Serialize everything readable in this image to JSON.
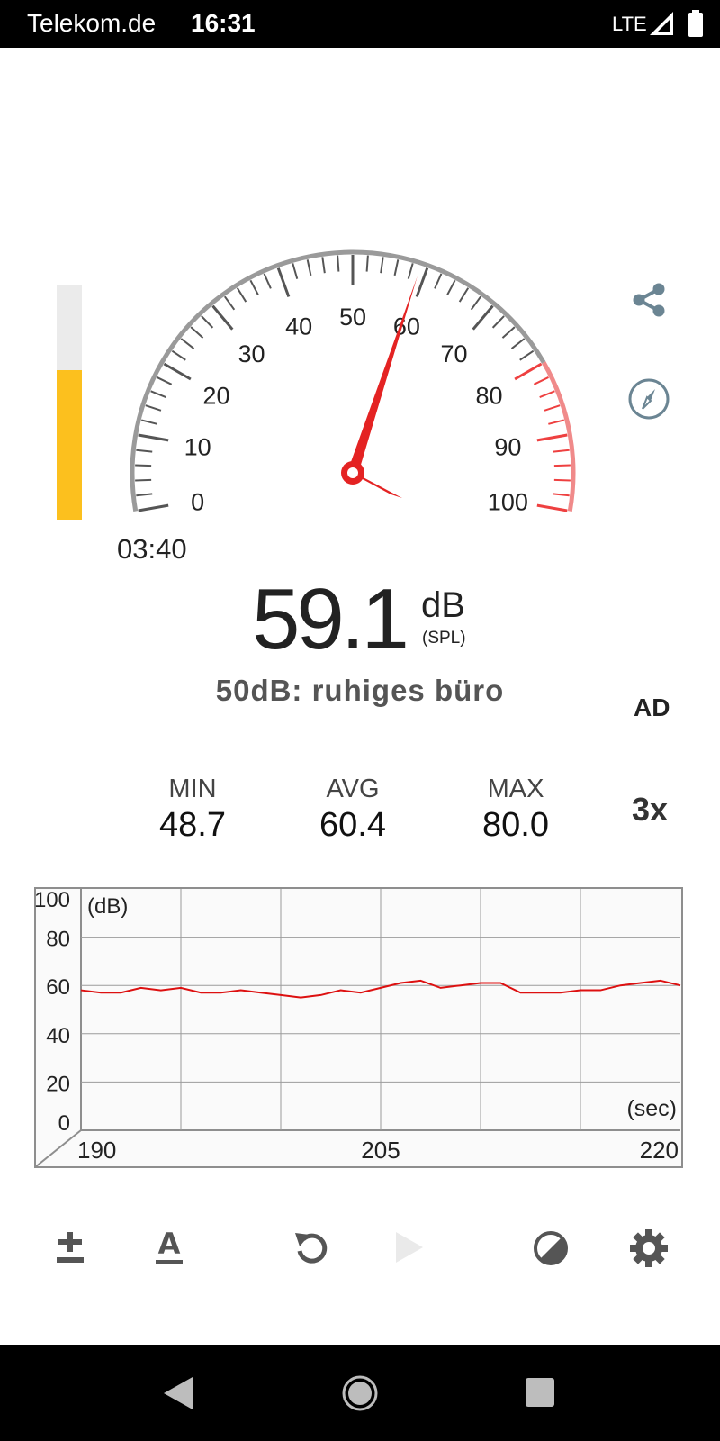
{
  "status_bar": {
    "carrier": "Telekom.de",
    "time": "16:31",
    "network": "LTE"
  },
  "level_meter": {
    "level": 0.64,
    "fill_color": "#fcc01e"
  },
  "gauge": {
    "tick_labels": [
      "0",
      "10",
      "20",
      "30",
      "40",
      "50",
      "60",
      "70",
      "80",
      "90",
      "100"
    ],
    "needle_value": 59.1,
    "danger_color": "#ee4040",
    "needle_color": "#e42323"
  },
  "timer": "03:40",
  "reading": {
    "value": "59.1",
    "unit": "dB",
    "unit_sub": "(SPL)",
    "description": "50dB: ruhiges büro"
  },
  "ad_label": "AD",
  "stats": {
    "min_label": "MIN",
    "min_value": "48.7",
    "avg_label": "AVG",
    "avg_value": "60.4",
    "max_label": "MAX",
    "max_value": "80.0"
  },
  "speed_label": "3x",
  "chart_data": {
    "type": "line",
    "ylabel": "(dB)",
    "xlabel": "(sec)",
    "ylim": [
      0,
      100
    ],
    "xlim": [
      190,
      220
    ],
    "y_ticks": [
      "100",
      "80",
      "60",
      "40",
      "20",
      "0"
    ],
    "x_ticks": [
      "190",
      "205",
      "220"
    ],
    "series": [
      {
        "color": "#dd1010",
        "x": [
          190,
          191,
          192,
          193,
          194,
          195,
          196,
          197,
          198,
          199,
          200,
          201,
          202,
          203,
          204,
          205,
          206,
          207,
          208,
          209,
          210,
          211,
          212,
          213,
          214,
          215,
          216,
          217,
          218,
          219,
          220
        ],
        "values": [
          58,
          57,
          57,
          59,
          58,
          59,
          57,
          57,
          58,
          57,
          56,
          55,
          56,
          58,
          57,
          59,
          61,
          62,
          59,
          60,
          61,
          61,
          57,
          57,
          57,
          58,
          58,
          60,
          61,
          62,
          60
        ]
      }
    ]
  },
  "toolbar": {
    "calibrate_icon": "plus-minus-icon",
    "weighting_icon": "a-weighting-icon",
    "reset_icon": "reset-icon",
    "play_icon": "play-icon",
    "theme_icon": "contrast-icon",
    "settings_icon": "gear-icon"
  }
}
